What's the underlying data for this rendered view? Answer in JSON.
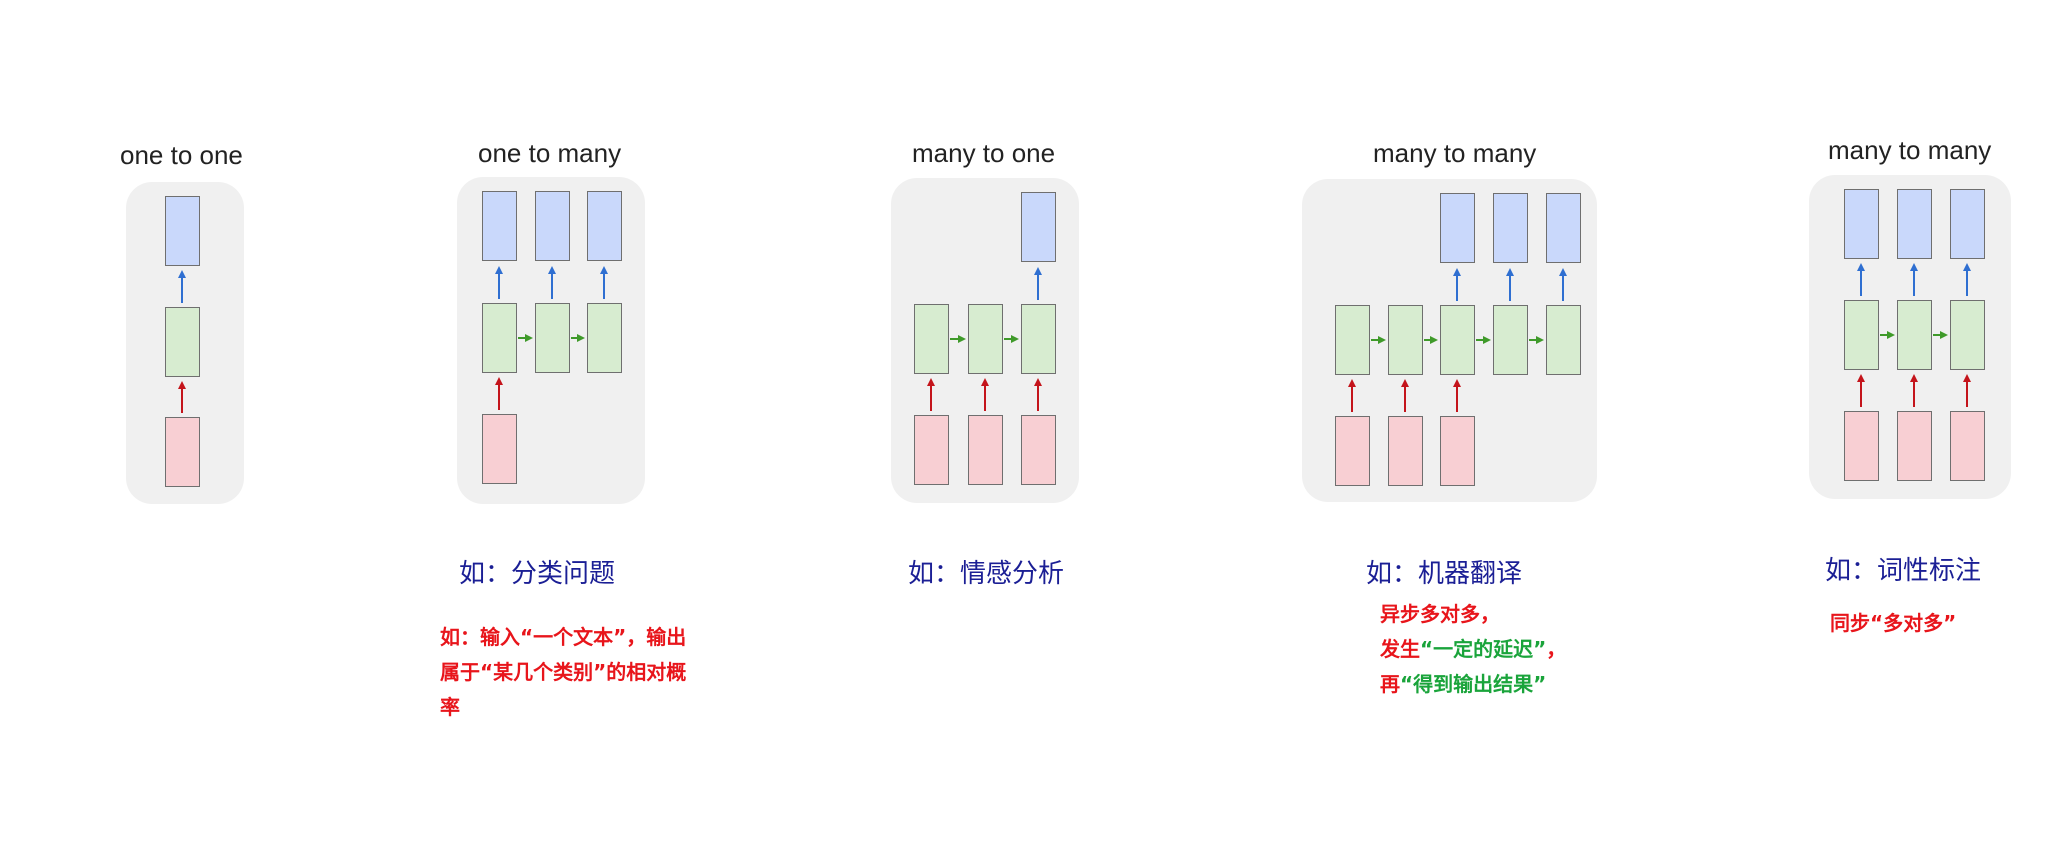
{
  "titles": {
    "one_to_one": "one to one",
    "one_to_many": "one to many",
    "many_to_one": "many to one",
    "many_to_many_1": "many to many",
    "many_to_many_2": "many to many"
  },
  "examples": {
    "one_to_many": "如：分类问题",
    "many_to_one": "如：情感分析",
    "many_to_many_1": "如：机器翻译",
    "many_to_many_2": "如：词性标注"
  },
  "notes": {
    "classification": "如：输入“一个文本”，输出属于“某几个类别”的相对概率",
    "async_line1": "异步多对多，",
    "async_line2_prefix": "发生",
    "async_line2_highlight": "“一定的延迟”",
    "async_line2_suffix": "，",
    "async_line3_prefix": "再",
    "async_line3_highlight": "“得到输出结果”",
    "sync": "同步“多对多”"
  },
  "colors": {
    "output_box": "#c9d8fb",
    "hidden_box": "#d7ecd0",
    "input_box": "#f8cfd3",
    "output_arrow": "#2f6fd1",
    "hidden_arrow": "#3f9a2a",
    "input_arrow": "#c4141b",
    "example_text": "#1b1f95",
    "note_red": "#e8151b",
    "note_green": "#1aa43b"
  }
}
